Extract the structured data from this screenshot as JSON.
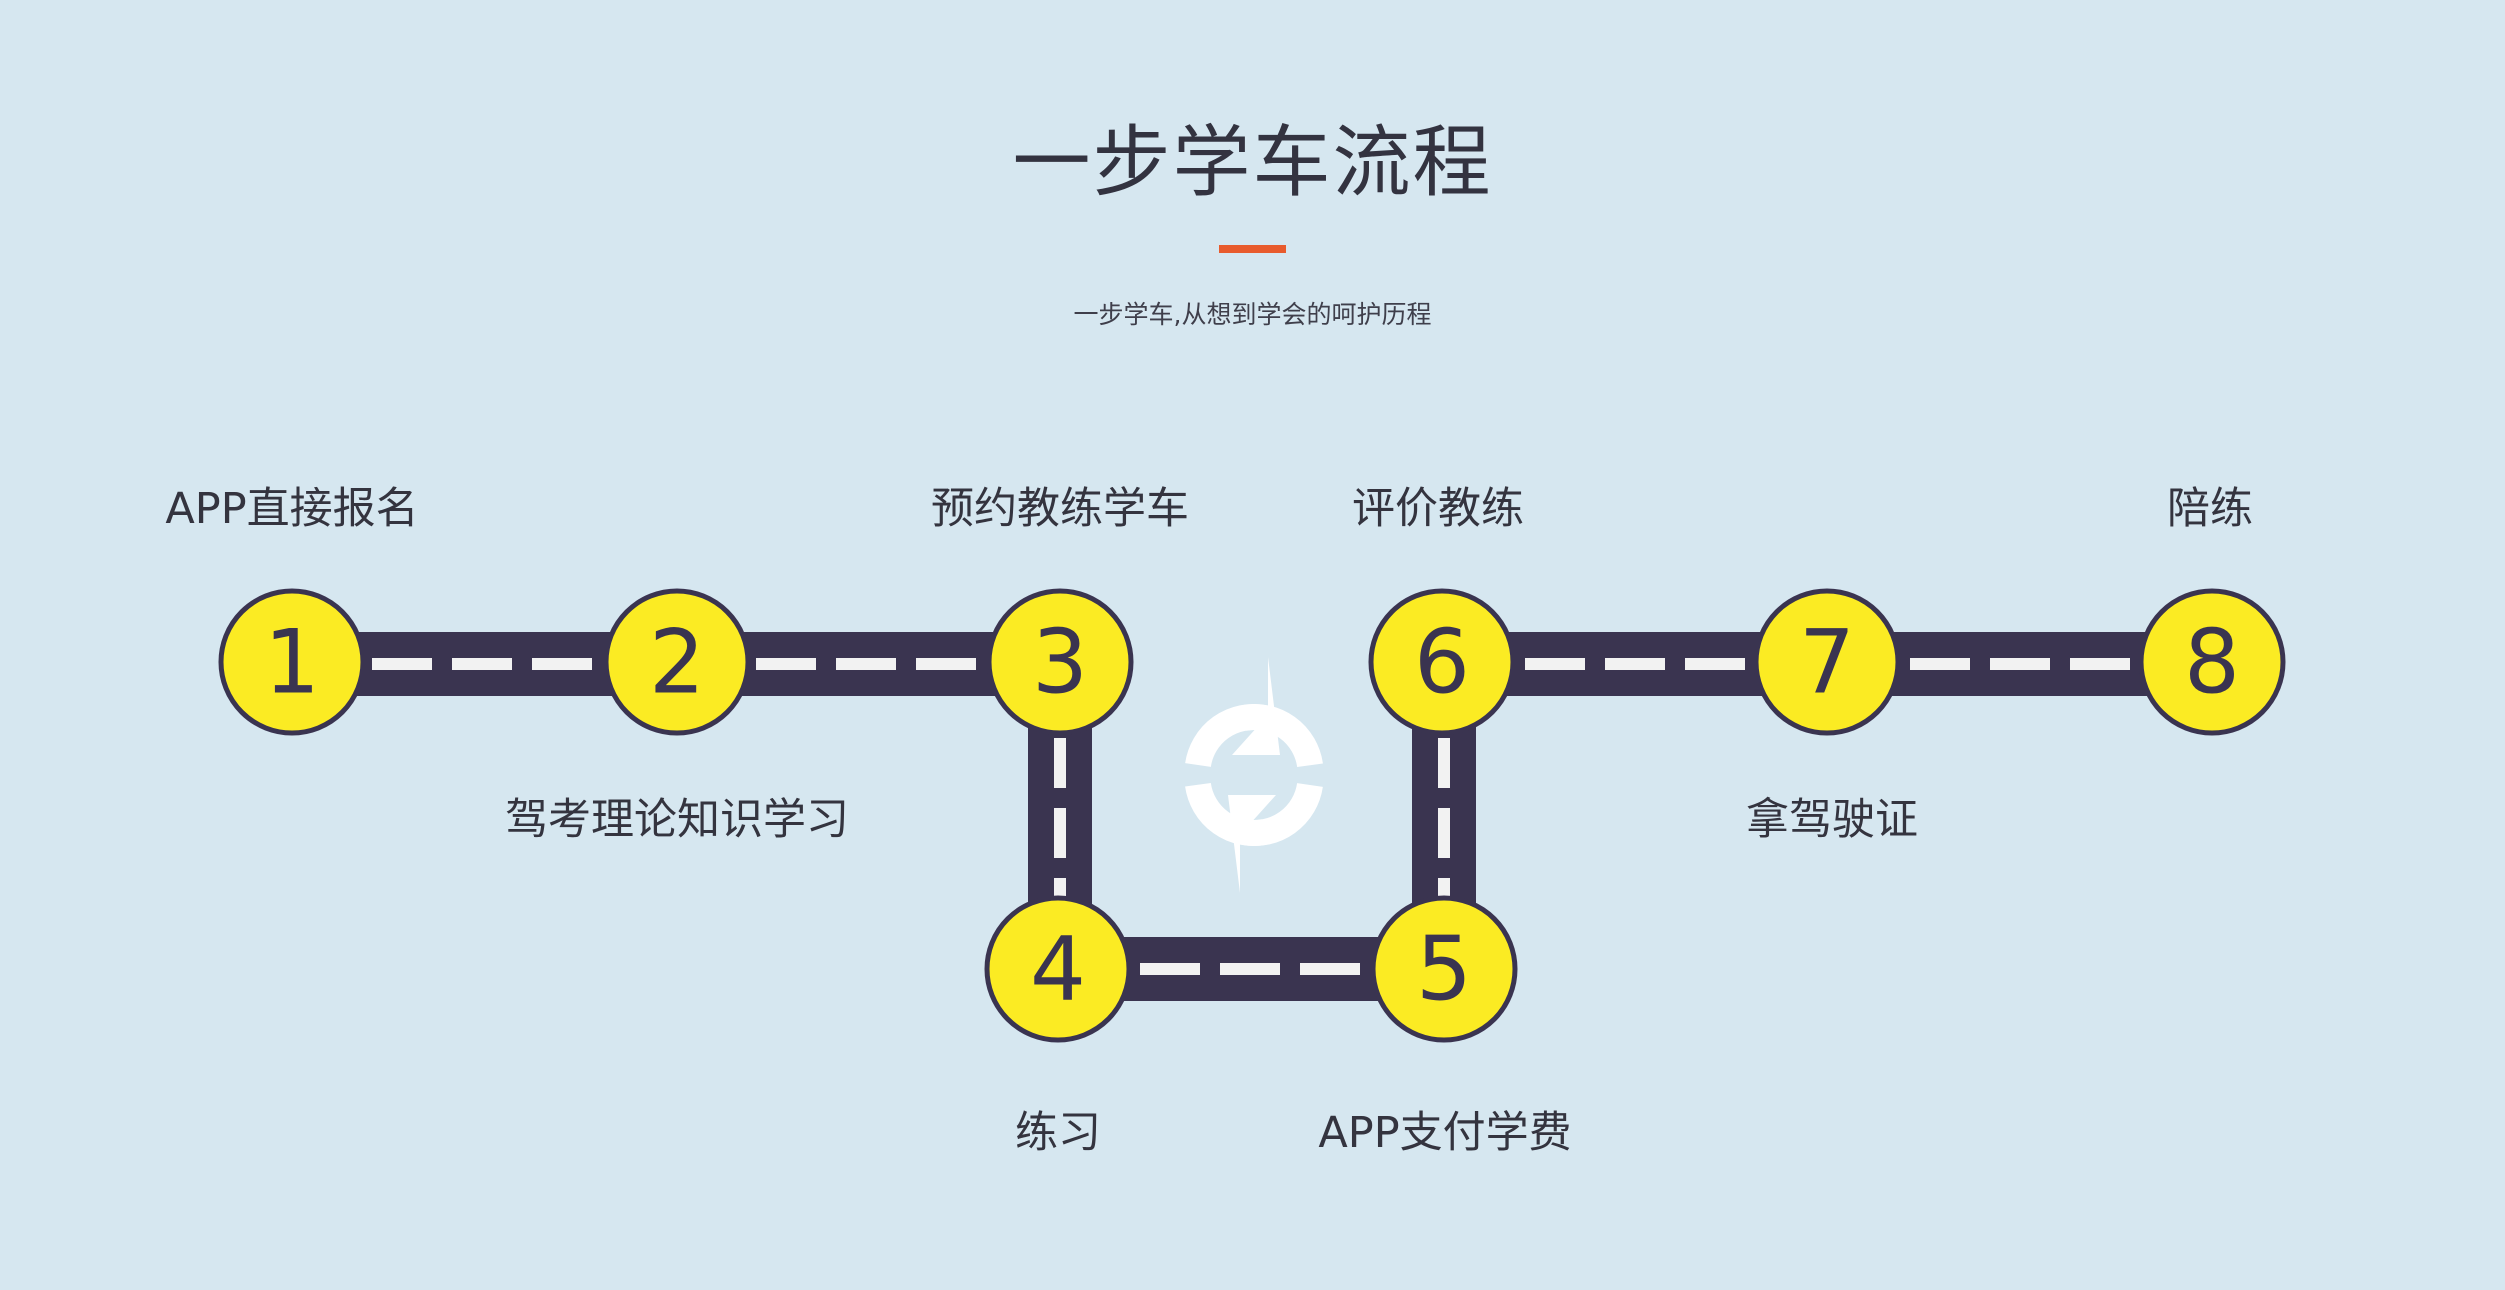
{
  "header": {
    "title": "一步学车流程",
    "subtitle": "一步学车,从想到学会的呵护历程"
  },
  "steps": [
    {
      "number": "1",
      "label": "APP直接报名"
    },
    {
      "number": "2",
      "label": "驾考理论知识学习"
    },
    {
      "number": "3",
      "label": "预约教练学车"
    },
    {
      "number": "4",
      "label": "练习"
    },
    {
      "number": "5",
      "label": "APP支付学费"
    },
    {
      "number": "6",
      "label": "评价教练"
    },
    {
      "number": "7",
      "label": "拿驾驶证"
    },
    {
      "number": "8",
      "label": "陪练"
    }
  ],
  "colors": {
    "background": "#d6e7f0",
    "road": "#3a3450",
    "lane_mark": "#f2f2f2",
    "node_fill": "#fbeb23",
    "node_border": "#3a3450",
    "accent": "#e85b2d"
  },
  "icons": {
    "cycle": "refresh-arrows-icon"
  }
}
